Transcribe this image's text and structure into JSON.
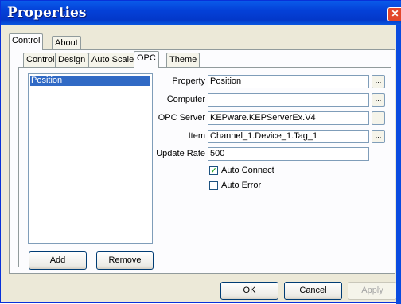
{
  "window": {
    "title": "Properties",
    "close_glyph": "✕"
  },
  "outer_tabs": [
    {
      "label": "Control",
      "active": true
    },
    {
      "label": "About",
      "active": false
    }
  ],
  "inner_tabs": [
    {
      "label": "Control",
      "active": false
    },
    {
      "label": "Design",
      "active": false
    },
    {
      "label": "Auto Scale",
      "active": false
    },
    {
      "label": "OPC",
      "active": true
    },
    {
      "label": "Theme",
      "active": false
    }
  ],
  "list": {
    "items": [
      "Position"
    ],
    "selected": "Position"
  },
  "list_buttons": {
    "add": "Add",
    "remove": "Remove"
  },
  "form": {
    "property": {
      "label": "Property",
      "value": "Position"
    },
    "computer": {
      "label": "Computer",
      "value": ""
    },
    "opc_server": {
      "label": "OPC Server",
      "value": "KEPware.KEPServerEx.V4"
    },
    "item": {
      "label": "Item",
      "value": "Channel_1.Device_1.Tag_1"
    },
    "update_rate": {
      "label": "Update Rate",
      "value": "500"
    },
    "browse_glyph": "...",
    "auto_connect": {
      "label": "Auto Connect",
      "checked": true
    },
    "auto_error": {
      "label": "Auto Error",
      "checked": false
    },
    "check_glyph": "✓"
  },
  "footer": {
    "ok": "OK",
    "cancel": "Cancel",
    "apply": "Apply"
  }
}
